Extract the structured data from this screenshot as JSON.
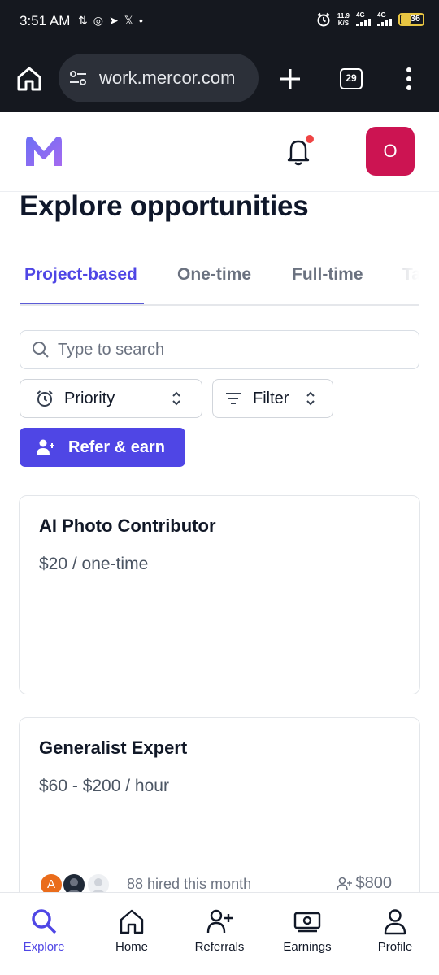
{
  "status_bar": {
    "time": "3:51 AM",
    "net_speed_value": "11.9",
    "net_speed_unit": "K/S",
    "signal_1": "4G",
    "signal_2": "4G",
    "battery": "36"
  },
  "browser": {
    "url": "work.mercor.com",
    "tab_count": "29"
  },
  "header": {
    "avatar_initial": "O",
    "accent_color": "#4f46e5",
    "avatar_color": "#cc1452"
  },
  "page": {
    "title": "Explore opportunities"
  },
  "tabs": [
    {
      "label": "Project-based",
      "active": true
    },
    {
      "label": "One-time",
      "active": false
    },
    {
      "label": "Full-time",
      "active": false
    },
    {
      "label": "Ta",
      "active": false
    }
  ],
  "search": {
    "placeholder": "Type to search"
  },
  "controls": {
    "priority_label": "Priority",
    "filter_label": "Filter",
    "refer_label": "Refer & earn"
  },
  "cards": [
    {
      "title": "AI Photo Contributor",
      "pay": "$20 / one-time"
    },
    {
      "title": "Generalist Expert",
      "pay": "$60 - $200 / hour",
      "avatar_initial": "A",
      "hired": "88 hired this month",
      "bonus": "$800"
    }
  ],
  "bottom_nav": [
    {
      "label": "Explore",
      "icon": "search-icon",
      "active": true
    },
    {
      "label": "Home",
      "icon": "home-icon",
      "active": false
    },
    {
      "label": "Referrals",
      "icon": "user-plus-icon",
      "active": false
    },
    {
      "label": "Earnings",
      "icon": "cash-icon",
      "active": false
    },
    {
      "label": "Profile",
      "icon": "user-icon",
      "active": false
    }
  ]
}
